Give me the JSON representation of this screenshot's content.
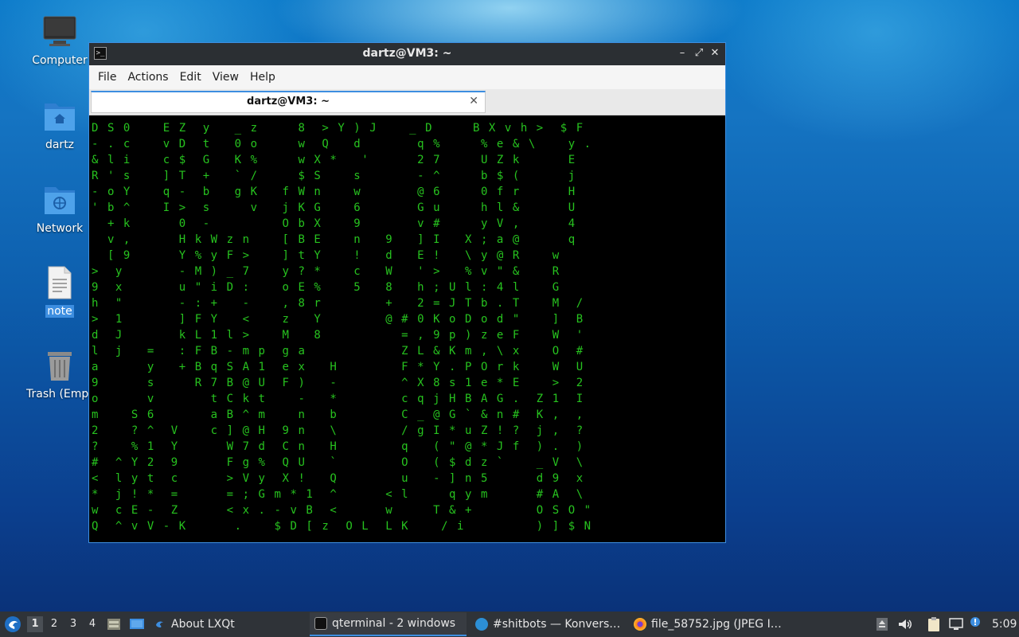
{
  "desktop": {
    "icons": [
      {
        "label": "Computer"
      },
      {
        "label": "dartz"
      },
      {
        "label": "Network"
      },
      {
        "label": "note"
      },
      {
        "label": "Trash (Empty)"
      }
    ]
  },
  "window": {
    "title": "dartz@VM3: ~",
    "app_icon": ">_",
    "controls": {
      "minimize": "–",
      "maximize": "⤢",
      "close": "✕"
    },
    "menu": [
      "File",
      "Actions",
      "Edit",
      "View",
      "Help"
    ],
    "tab": {
      "label": "dartz@VM3: ~",
      "close": "✕"
    },
    "terminal_columns": [
      ">9h>dlaa9om2?#<*wQ",
      "",
      "D-&R-'",
      "",
      "S.l'ob+v[yx\"1Jj",
      "",
      "0cisY^k,9",
      "",
      "",
      "",
      "",
      "S?%^ljc^",
      "",
      "=ys66^1Y2!E-v",
      "",
      "Evc]qI",
      "",
      "",
      "V",
      "",
      "",
      "",
      "Z",
      "",
      "ZD$T->0HY-u-]k",
      "",
      "",
      "",
      "",
      "",
      "",
      "",
      "",
      "+RtacW9c=<",
      "",
      "",
      "",
      "",
      "",
      "",
      "",
      "",
      "",
      "",
      "",
      "",
      "",
      "",
      "",
      "",
      "",
      "",
      "",
      "",
      "",
      "",
      "",
      "",
      "",
      "",
      "",
      "",
      "",
      "",
      "",
      "",
      "",
      "",
      "",
      "",
      "",
      "",
      "",
      "",
      "",
      "",
      "",
      "",
      "",
      "",
      "",
      "",
      "",
      "",
      "",
      "",
      "",
      "",
      "",
      "",
      ""
    ],
    "terminal_rows": [
      "D S 0    E Z  y   _ z     8  > Y ) J    _ D     B X v h >  $ F",
      "- . c    v D  t   0 o     w  Q   d       q %     % e & \\    y .",
      "& l i    c $  G   K %     w X *   '      2 7     U Z k      E",
      "R ' s    ] T  +   ` /     $ S    s       - ^     b $ (      j",
      "- o Y    q -  b   g K   f W n    w       @ 6     0 f r      H",
      "' b ^    I >  s     v   j K G    6       G u     h l &      U",
      "  + k      0  -         O b X    9       v #     y V ,      4",
      "  v ,      H k W z n    [ B E    n   9   ] I   X ; a @      q",
      "  [ 9      Y % y F >    ] t Y    !   d   E !   \\ y @ R    w",
      ">  y       - M ) _ 7    y ? *    c   W   ' >   % v \" &    R",
      "9  x       u \" i D :    o E %    5   8   h ; U l : 4 l    G",
      "h  \"       - : +   -    , 8 r        +   2 = J T b . T    M  /",
      ">  1       ] F Y   <    z   Y        @ # 0 K o D o d \"    ]  B",
      "d  J       k L 1 l >    M   8          = , 9 p ) z e F    W  '",
      "l  j   =   : F B - m p  g a            Z L & K m , \\ x    O  #",
      "a      y   + B q S A 1  e x   H        F * Y . P O r k    W  U",
      "9      s     R 7 B @ U  F )   -        ^ X 8 s 1 e * E    >  2",
      "o      v       t C k t    -   *        c q j H B A G .  Z 1  I",
      "m    S 6       a B ^ m    n   b        C _ @ G ` & n #  K ,  ,",
      "2    ? ^  V    c ] @ H  9 n   \\        / g I * u Z ! ?  j ,  ?",
      "?    % 1  Y      W 7 d  C n   H        q   ( \" @ * J f  ) .  )",
      "#  ^ Y 2  9      F g %  Q U   `        O   ( $ d z `    _ V  \\",
      "<  l y t  c      > V y  X !   Q        u   - ] n 5      d 9  x",
      "*  j ! *  =      = ; G m * 1  ^      < l     q y m      # A  \\",
      "w  c E -  Z      < x . - v B  <      w     T & +        O S O \"",
      "Q  ^ v V - K      .    $ D [ z  O L  L K    / i         ) ] $ N"
    ]
  },
  "taskbar": {
    "workspaces": [
      "1",
      "2",
      "3",
      "4"
    ],
    "tasks": [
      {
        "label": "About LXQt"
      },
      {
        "label": "qterminal - 2 windows"
      },
      {
        "label": "#shitbots — Konvers…"
      },
      {
        "label": "file_58752.jpg (JPEG I…"
      }
    ],
    "clock": "5:09"
  },
  "colors": {
    "accent": "#3d8ee0",
    "terminal_text": "#27c21f",
    "terminal_highlight": "#e0e0e0",
    "terminal_bg": "#000000",
    "panel": "#2f3338"
  }
}
